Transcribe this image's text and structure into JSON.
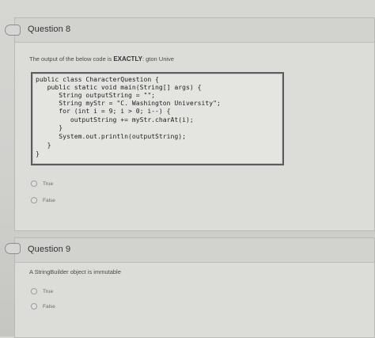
{
  "question8": {
    "title": "Question 8",
    "prompt_prefix": "The output of the below code is ",
    "prompt_emphasis": "EXACTLY",
    "prompt_suffix": ": gton Unive",
    "code": [
      "public class CharacterQuestion {",
      "   public static void main(String[] args) {",
      "      String outputString = \"\";",
      "      String myStr = \"C. Washington University\";",
      "      for (int i = 9; i > 0; i--) {",
      "         outputString += myStr.charAt(i);",
      "      }",
      "      System.out.println(outputString);",
      "   }",
      "}"
    ],
    "options": [
      "True",
      "False"
    ]
  },
  "question9": {
    "title": "Question 9",
    "prompt": "A StringBuilder object is immutable",
    "options": [
      "True",
      "False"
    ]
  }
}
